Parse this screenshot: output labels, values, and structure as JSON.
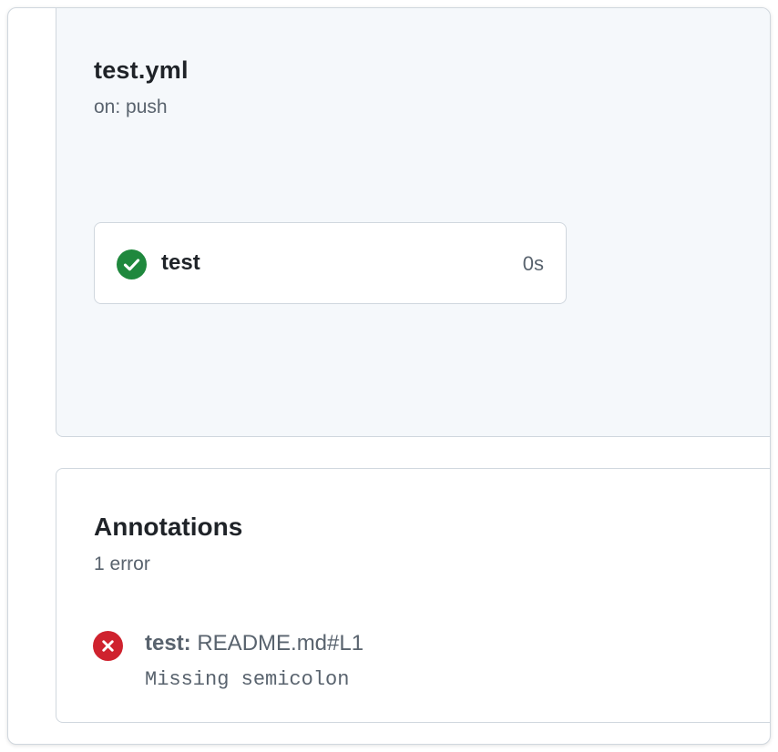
{
  "workflow": {
    "file_name": "test.yml",
    "trigger": "on: push",
    "job": {
      "name": "test",
      "duration": "0s",
      "status": "success",
      "status_icon": "check-circle-icon",
      "status_color": "#1f883d"
    }
  },
  "annotations": {
    "title": "Annotations",
    "count_label": "1 error",
    "items": [
      {
        "job": "test:",
        "location": "README.md#L1",
        "message": "Missing semicolon",
        "severity_icon": "x-circle-icon",
        "severity_color": "#cf222e"
      }
    ]
  },
  "colors": {
    "panel_background": "#f5f8fb",
    "border": "#d0d7de",
    "muted_text": "#59636e",
    "primary_text": "#1f2328"
  }
}
